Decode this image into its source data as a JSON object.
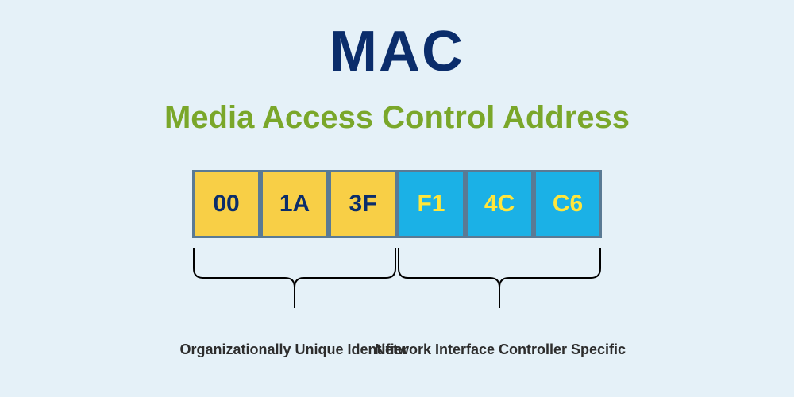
{
  "title": "MAC",
  "subtitle": "Media Access Control Address",
  "octets": {
    "oui": [
      "00",
      "1A",
      "3F"
    ],
    "nic": [
      "F1",
      "4C",
      "C6"
    ]
  },
  "labels": {
    "left": "Organizationally Unique Identifier",
    "right": "Network Interface Controller Specific"
  },
  "colors": {
    "bg": "#e5f1f8",
    "title": "#0b2d6b",
    "subtitle": "#7aa72a",
    "octet_border": "#5a7a94",
    "octet_yellow_bg": "#f8cf46",
    "octet_yellow_text": "#0b2d6b",
    "octet_blue_bg": "#1bb1e6",
    "octet_blue_text": "#ffe63b"
  }
}
